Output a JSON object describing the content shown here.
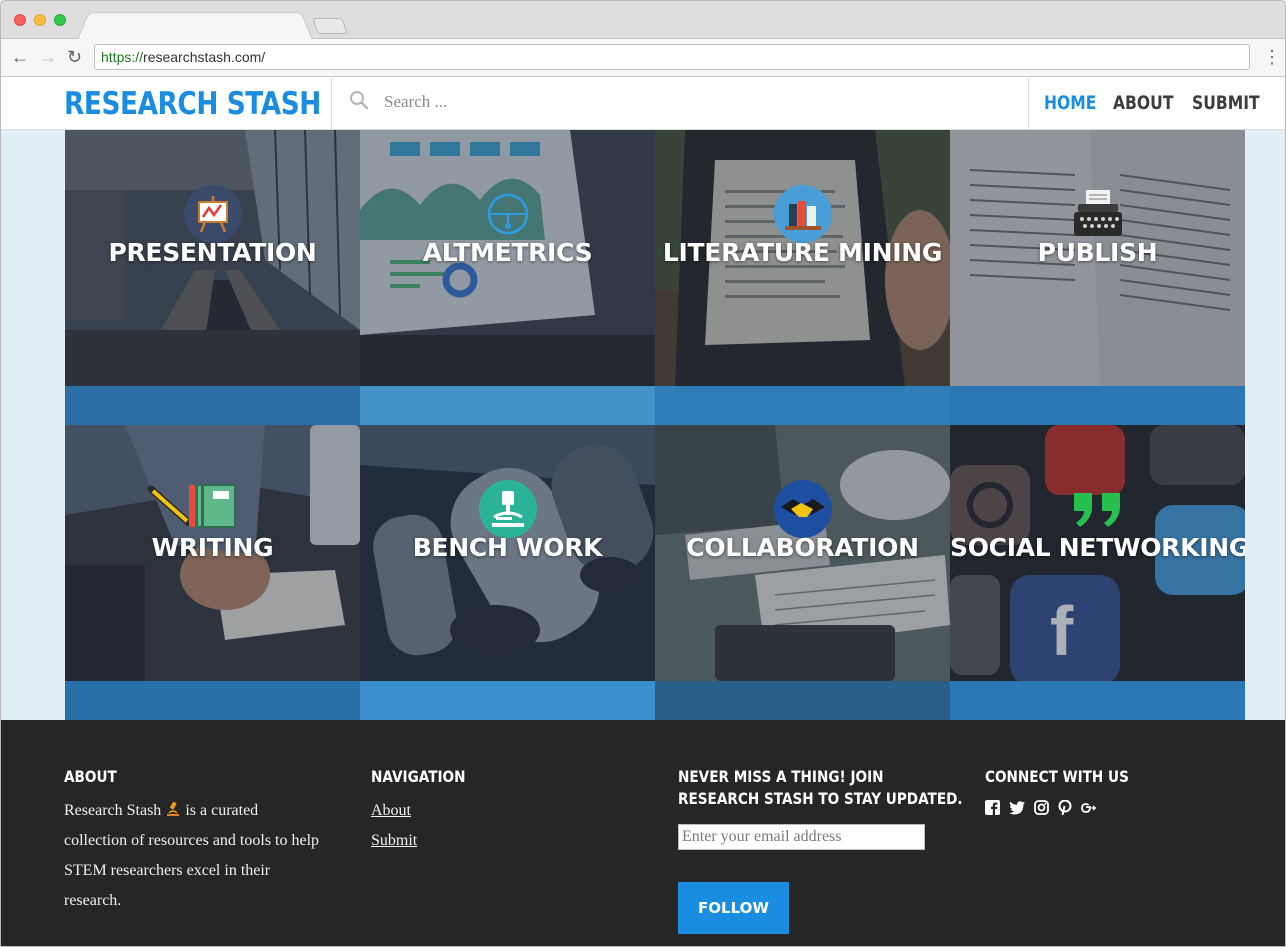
{
  "browser": {
    "url_scheme": "https://",
    "url_rest": "researchstash.com/"
  },
  "header": {
    "logo": "RESEARCH STASH",
    "search_placeholder": "Search ...",
    "nav": [
      {
        "label": "HOME",
        "active": true
      },
      {
        "label": "ABOUT",
        "active": false
      },
      {
        "label": "SUBMIT",
        "active": false
      }
    ]
  },
  "cards": [
    {
      "title": "PRESENTATION",
      "icon": "easel-chart-icon"
    },
    {
      "title": "ALTMETRICS",
      "icon": "gauge-icon"
    },
    {
      "title": "LITERATURE MINING",
      "icon": "books-icon"
    },
    {
      "title": "PUBLISH",
      "icon": "typewriter-icon"
    },
    {
      "title": "WRITING",
      "icon": "notebook-pencil-icon"
    },
    {
      "title": "BENCH WORK",
      "icon": "microscope-icon"
    },
    {
      "title": "COLLABORATION",
      "icon": "handshake-icon"
    },
    {
      "title": "SOCIAL NETWORKING",
      "icon": "quote-icon"
    }
  ],
  "footer": {
    "about_heading": "ABOUT",
    "about_text_1": "Research Stash",
    "about_text_2": "is a curated collection of resources and tools to help STEM researchers excel in their research.",
    "nav_heading": "NAVIGATION",
    "nav_links": [
      "About",
      "Submit"
    ],
    "newsletter_heading_1": "NEVER MISS A THING! JOIN",
    "newsletter_heading_2": "RESEARCH STASH TO STAY UPDATED.",
    "email_placeholder": "Enter your email address",
    "follow_label": "FOLLOW",
    "connect_heading": "CONNECT WITH US",
    "social": [
      "facebook-icon",
      "twitter-icon",
      "instagram-icon",
      "pinterest-icon",
      "google-plus-icon"
    ]
  },
  "colors": {
    "accent": "#1a8de0",
    "footer_bg": "#262626",
    "page_bg": "#e1eef6"
  }
}
